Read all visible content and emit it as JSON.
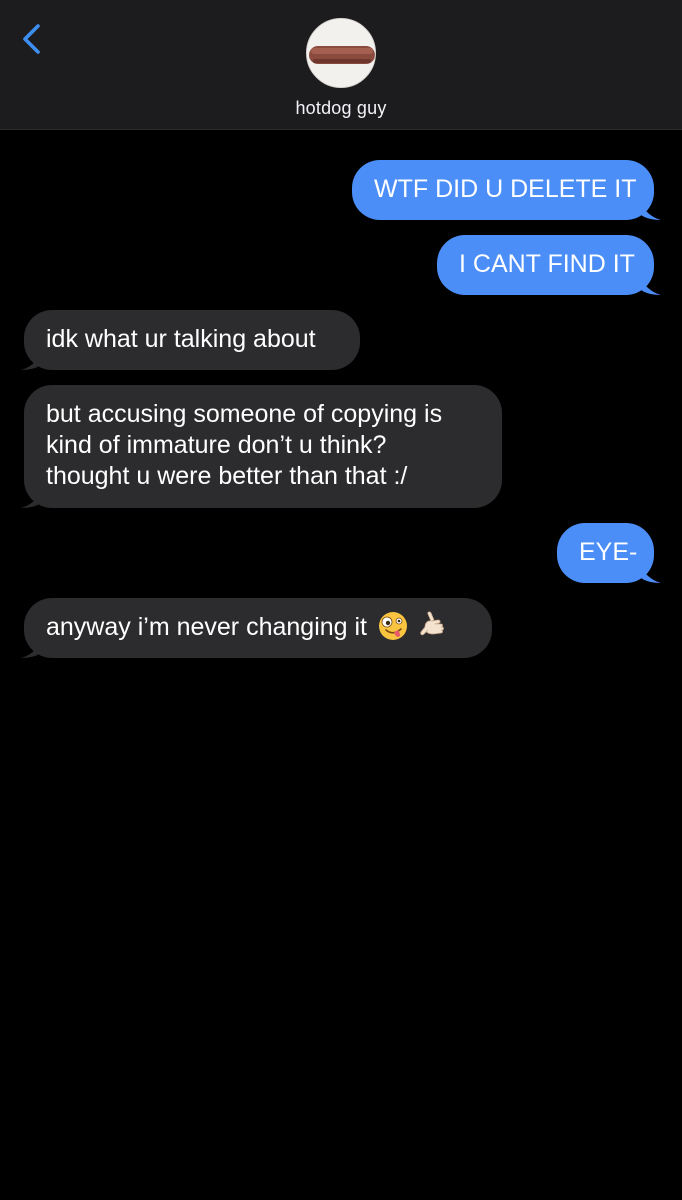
{
  "header": {
    "contact_name": "hotdog guy",
    "back_icon": "chevron-left-icon",
    "avatar_icon": "hotdog-avatar"
  },
  "colors": {
    "sent_bubble": "#4b8ef7",
    "received_bubble": "#2c2c2e",
    "background": "#000000",
    "header_bg": "#1c1c1e",
    "accent": "#3e8ef2"
  },
  "messages": [
    {
      "direction": "sent",
      "text": "WTF DID U DELETE IT"
    },
    {
      "direction": "sent",
      "text": "I CANT FIND IT"
    },
    {
      "direction": "received",
      "text": "idk what ur talking about"
    },
    {
      "direction": "received",
      "lines": [
        "but accusing someone of copying is",
        "kind of immature don’t u think?",
        "thought u were better than that :/"
      ]
    },
    {
      "direction": "sent",
      "text": "EYE-"
    },
    {
      "direction": "received",
      "text": "anyway i’m never changing it",
      "emojis": [
        "zany-face-emoji",
        "call-me-hand-emoji"
      ]
    }
  ]
}
